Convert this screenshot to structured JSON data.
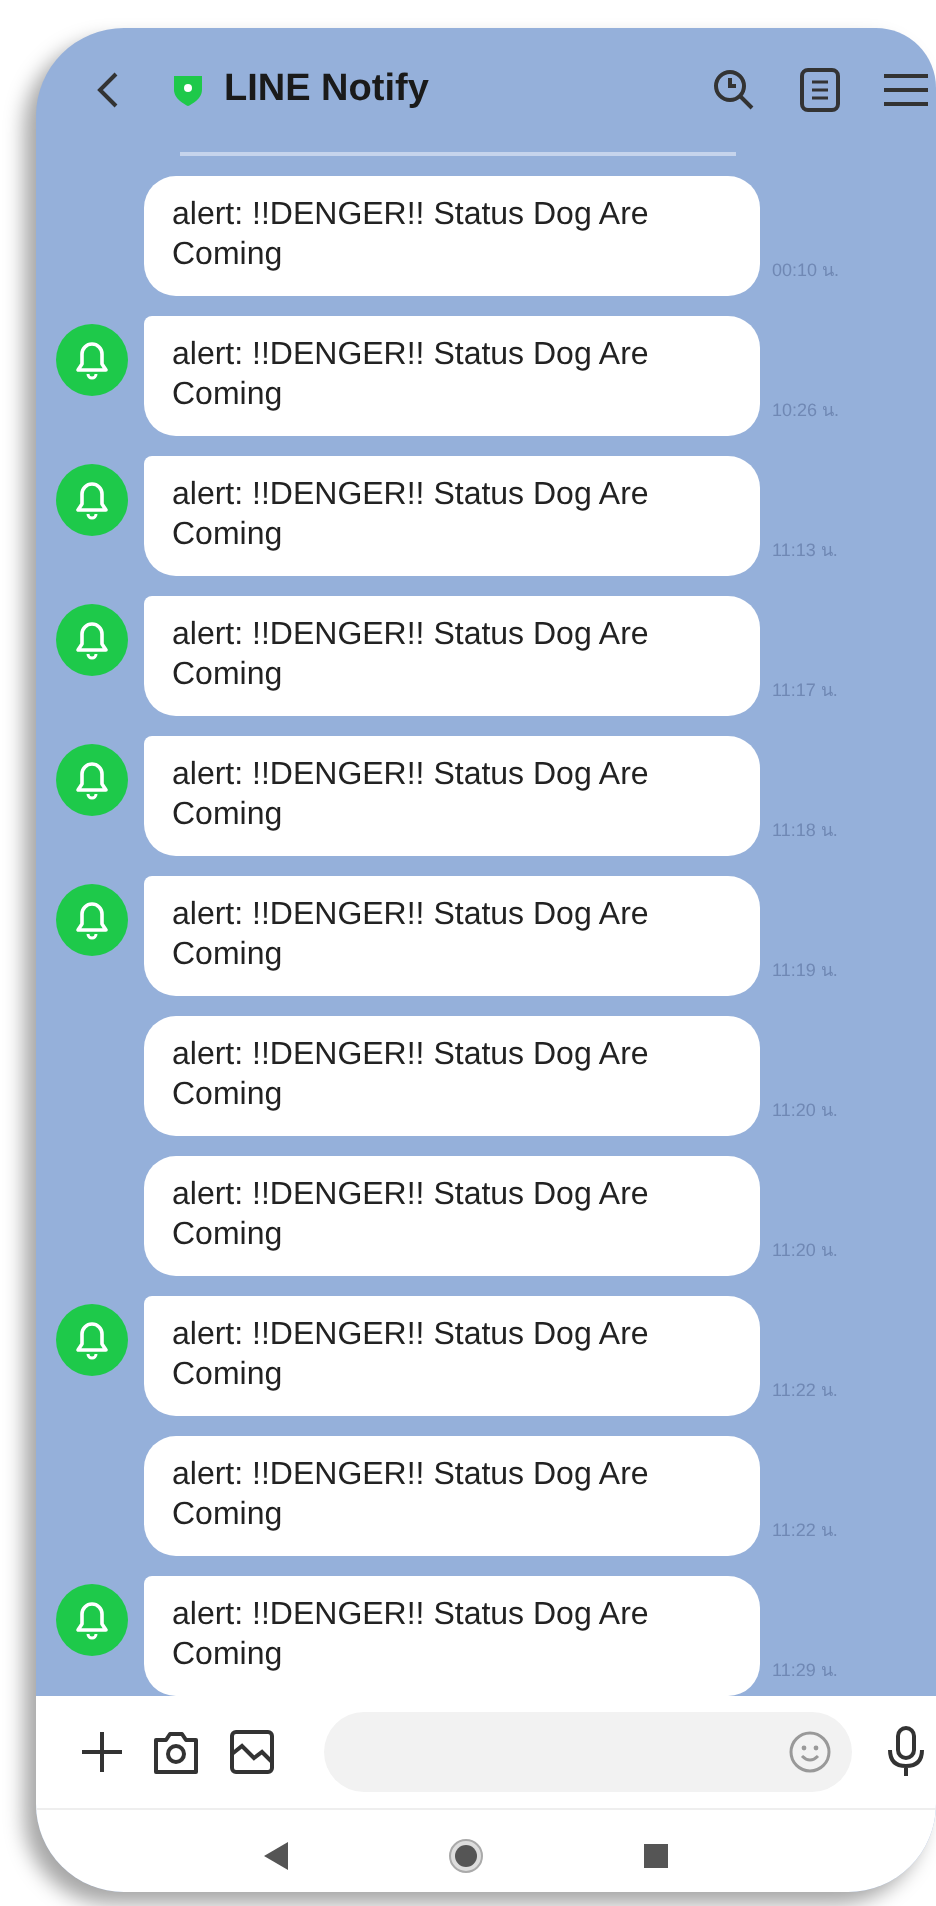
{
  "header": {
    "title": "LINE Notify"
  },
  "messages": [
    {
      "text": "alert: !!DENGER!! Status Dog Are Coming",
      "time": "00:10 น.",
      "avatar": false
    },
    {
      "text": "alert: !!DENGER!! Status Dog Are Coming",
      "time": "10:26 น.",
      "avatar": true
    },
    {
      "text": "alert: !!DENGER!! Status Dog Are Coming",
      "time": "11:13 น.",
      "avatar": true
    },
    {
      "text": "alert: !!DENGER!! Status Dog Are Coming",
      "time": "11:17 น.",
      "avatar": true
    },
    {
      "text": "alert: !!DENGER!! Status Dog Are Coming",
      "time": "11:18 น.",
      "avatar": true
    },
    {
      "text": "alert: !!DENGER!! Status Dog Are Coming",
      "time": "11:19 น.",
      "avatar": true
    },
    {
      "text": "alert: !!DENGER!! Status Dog Are Coming",
      "time": "11:20 น.",
      "avatar": false
    },
    {
      "text": "alert: !!DENGER!! Status Dog Are Coming",
      "time": "11:20 น.",
      "avatar": false
    },
    {
      "text": "alert: !!DENGER!! Status Dog Are Coming",
      "time": "11:22 น.",
      "avatar": true
    },
    {
      "text": "alert: !!DENGER!! Status Dog Are Coming",
      "time": "11:22 น.",
      "avatar": false
    },
    {
      "text": "alert: !!DENGER!! Status Dog Are Coming",
      "time": "11:29 น.",
      "avatar": true
    }
  ]
}
